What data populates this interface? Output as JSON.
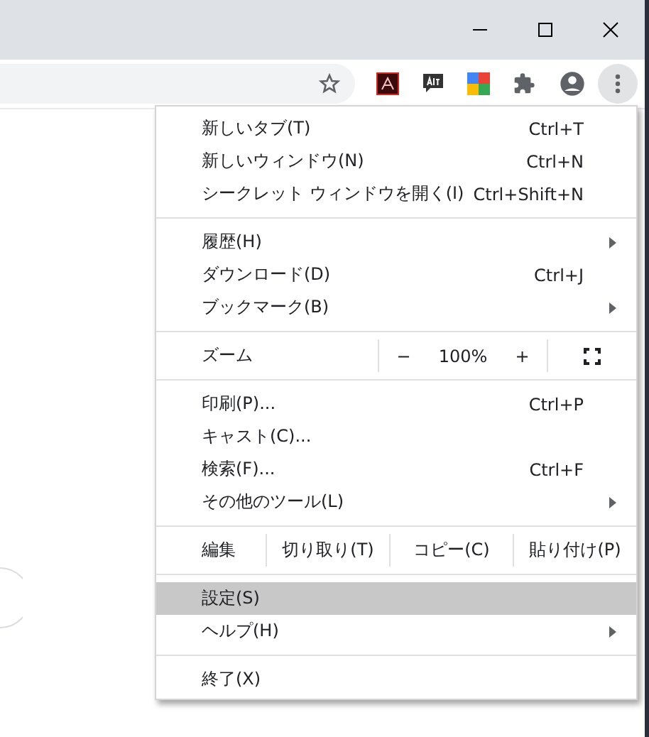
{
  "menu": {
    "sections": [
      {
        "items": [
          {
            "kind": "item",
            "label": "新しいタブ(T)",
            "shortcut": "Ctrl+T",
            "submenu": false,
            "highlighted": false
          },
          {
            "kind": "item",
            "label": "新しいウィンドウ(N)",
            "shortcut": "Ctrl+N",
            "submenu": false,
            "highlighted": false
          },
          {
            "kind": "item",
            "label": "シークレット ウィンドウを開く(I)",
            "shortcut": "Ctrl+Shift+N",
            "submenu": false,
            "highlighted": false
          }
        ]
      },
      {
        "items": [
          {
            "kind": "item",
            "label": "履歴(H)",
            "submenu": true,
            "highlighted": false
          },
          {
            "kind": "item",
            "label": "ダウンロード(D)",
            "shortcut": "Ctrl+J",
            "submenu": false,
            "highlighted": false
          },
          {
            "kind": "item",
            "label": "ブックマーク(B)",
            "submenu": true,
            "highlighted": false
          }
        ]
      },
      {
        "items": [
          {
            "kind": "zoom",
            "label": "ズーム",
            "minus": "−",
            "value": "100%",
            "plus": "+"
          }
        ]
      },
      {
        "items": [
          {
            "kind": "item",
            "label": "印刷(P)...",
            "shortcut": "Ctrl+P",
            "submenu": false,
            "highlighted": false
          },
          {
            "kind": "item",
            "label": "キャスト(C)...",
            "submenu": false,
            "highlighted": false
          },
          {
            "kind": "item",
            "label": "検索(F)...",
            "shortcut": "Ctrl+F",
            "submenu": false,
            "highlighted": false
          },
          {
            "kind": "item",
            "label": "その他のツール(L)",
            "submenu": true,
            "highlighted": false
          }
        ]
      },
      {
        "items": [
          {
            "kind": "edit",
            "label": "編集",
            "actions": [
              "切り取り(T)",
              "コピー(C)",
              "貼り付け(P)"
            ]
          }
        ]
      },
      {
        "items": [
          {
            "kind": "item",
            "label": "設定(S)",
            "submenu": false,
            "highlighted": true
          },
          {
            "kind": "item",
            "label": "ヘルプ(H)",
            "submenu": true,
            "highlighted": false
          }
        ]
      },
      {
        "items": [
          {
            "kind": "item",
            "label": "終了(X)",
            "submenu": false,
            "highlighted": false
          }
        ]
      }
    ]
  }
}
